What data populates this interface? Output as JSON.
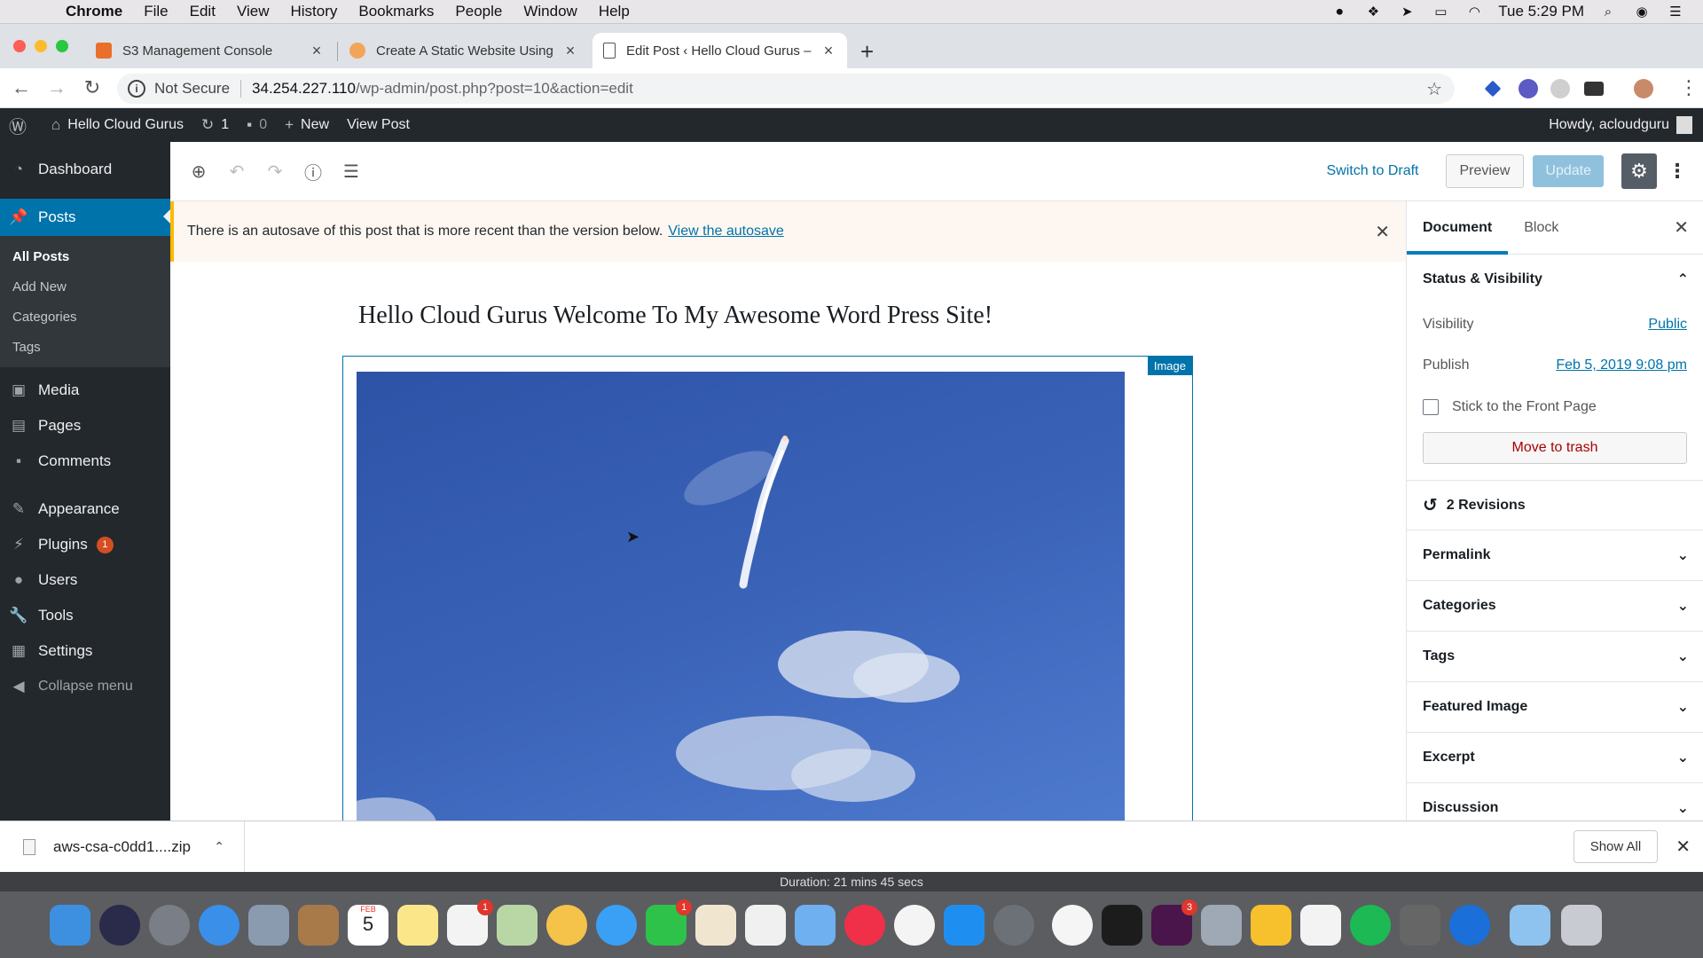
{
  "menubar": {
    "app_name": "Chrome",
    "items": [
      "File",
      "Edit",
      "View",
      "History",
      "Bookmarks",
      "People",
      "Window",
      "Help"
    ],
    "clock": "Tue 5:29 PM"
  },
  "tabs": [
    {
      "label": "S3 Management Console",
      "active": false,
      "favicon_color": "#e8702a"
    },
    {
      "label": "Create A Static Website Using",
      "active": false,
      "favicon_color": "#f2a55a"
    },
    {
      "label": "Edit Post ‹ Hello Cloud Gurus –",
      "active": true,
      "favicon_color": "#ffffff"
    }
  ],
  "address": {
    "security": "Not Secure",
    "host": "34.254.227.110",
    "path": "/wp-admin/post.php?post=10&action=edit"
  },
  "adminbar": {
    "site_name": "Hello Cloud Gurus",
    "updates_count": "1",
    "comments_count": "0",
    "new_label": "New",
    "view_post": "View Post",
    "howdy": "Howdy, acloudguru"
  },
  "sidebar": {
    "dashboard": "Dashboard",
    "posts": "Posts",
    "posts_sub": [
      "All Posts",
      "Add New",
      "Categories",
      "Tags"
    ],
    "media": "Media",
    "pages": "Pages",
    "comments": "Comments",
    "appearance": "Appearance",
    "plugins": "Plugins",
    "plugins_badge": "1",
    "users": "Users",
    "tools": "Tools",
    "settings": "Settings",
    "collapse": "Collapse menu"
  },
  "editor_header": {
    "switch_to_draft": "Switch to Draft",
    "preview": "Preview",
    "update": "Update"
  },
  "notice": {
    "text": "There is an autosave of this post that is more recent than the version below.",
    "link": "View the autosave"
  },
  "post": {
    "title": "Hello Cloud Gurus Welcome To My Awesome Word Press Site!",
    "block_label": "Image"
  },
  "settings_panel": {
    "tab_document": "Document",
    "tab_block": "Block",
    "status_heading": "Status & Visibility",
    "visibility_label": "Visibility",
    "visibility_value": "Public",
    "publish_label": "Publish",
    "publish_value": "Feb 5, 2019 9:08 pm",
    "stick_label": "Stick to the Front Page",
    "trash": "Move to trash",
    "revisions": "2 Revisions",
    "panels": [
      "Permalink",
      "Categories",
      "Tags",
      "Featured Image",
      "Excerpt",
      "Discussion"
    ]
  },
  "download_shelf": {
    "file_name": "aws-csa-c0dd1....zip",
    "show_all": "Show All"
  },
  "player": {
    "duration": "Duration: 21 mins 45 secs"
  },
  "dock": {
    "calendar_month": "FEB",
    "calendar_day": "5",
    "badges": {
      "reminders": "1",
      "facetime": "1",
      "slack": "3"
    }
  }
}
